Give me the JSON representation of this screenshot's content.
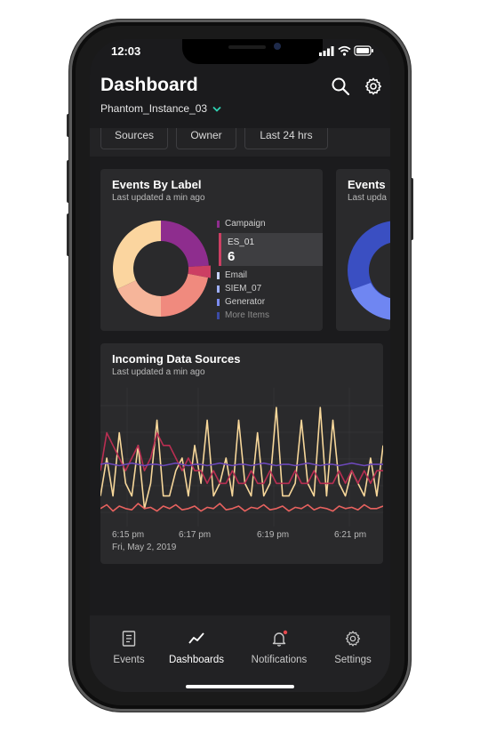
{
  "status_bar": {
    "time": "12:03"
  },
  "header": {
    "title": "Dashboard",
    "instance": "Phantom_Instance_03"
  },
  "filters": [
    "Sources",
    "Owner",
    "Last 24 hrs"
  ],
  "events_by_label": {
    "title": "Events By Label",
    "updated": "Last updated a min ago",
    "legend": [
      {
        "label": "Campaign",
        "color": "#8e2d8e"
      },
      {
        "label": "ES_01",
        "value": "6",
        "color": "#cc3f63"
      },
      {
        "label": "Email",
        "color": "#c8d3ff"
      },
      {
        "label": "SIEM_07",
        "color": "#9fb0ff"
      },
      {
        "label": "Generator",
        "color": "#7b8cf0"
      },
      {
        "label": "More Items",
        "color": "#3b4aa5"
      }
    ]
  },
  "events_second_card": {
    "title": "Events",
    "updated": "Last upda"
  },
  "incoming": {
    "title": "Incoming Data Sources",
    "updated": "Last updated a min ago",
    "x_ticks": [
      "6:15 pm",
      "6:17 pm",
      "6:19 pm",
      "6:21 pm"
    ],
    "date": "Fri, May 2, 2019"
  },
  "chart_data": {
    "type": "line",
    "title": "Incoming Data Sources",
    "x": [
      "6:15 pm",
      "6:17 pm",
      "6:19 pm",
      "6:21 pm"
    ],
    "series": [
      {
        "color": "#f7d79a",
        "values": [
          2,
          5,
          2,
          7,
          3,
          2,
          6,
          1,
          3,
          8,
          2,
          2,
          4,
          5,
          2,
          6,
          3,
          8,
          2,
          3,
          5,
          2,
          8,
          3,
          2,
          7,
          2,
          3,
          9,
          2,
          2,
          3,
          8,
          3,
          2,
          9,
          2,
          8,
          3,
          2,
          4,
          3,
          2,
          5,
          2,
          6
        ]
      },
      {
        "color": "#b92e52",
        "values": [
          4,
          7,
          6,
          5,
          4,
          5,
          6,
          4,
          5,
          7,
          6,
          6,
          5,
          4,
          5,
          4,
          4,
          3,
          4,
          3,
          3,
          4,
          3,
          3,
          4,
          3,
          3,
          4,
          3,
          3,
          3,
          4,
          3,
          3,
          4,
          3,
          3,
          3,
          4,
          3,
          4,
          3,
          4,
          3,
          4,
          4
        ]
      },
      {
        "color": "#6c48b8",
        "values": [
          4.5,
          4.6,
          4.5,
          4.4,
          4.5,
          4.6,
          4.5,
          4.4,
          4.5,
          4.5,
          4.4,
          4.5,
          4.6,
          4.5,
          4.4,
          4.5,
          4.5,
          4.4,
          4.5,
          4.6,
          4.5,
          4.4,
          4.5,
          4.5,
          4.4,
          4.5,
          4.6,
          4.5,
          4.4,
          4.5,
          4.5,
          4.4,
          4.5,
          4.6,
          4.5,
          4.4,
          4.5,
          4.5,
          4.4,
          4.5,
          4.6,
          4.5,
          4.4,
          4.5,
          4.5,
          4.5
        ]
      },
      {
        "color": "#e8625f",
        "values": [
          1,
          1.3,
          0.8,
          1.2,
          1,
          0.9,
          1.4,
          1,
          1.1,
          0.8,
          1.2,
          1,
          1.3,
          0.9,
          1,
          1.2,
          0.8,
          1.1,
          1,
          1.4,
          0.9,
          1,
          1.2,
          0.8,
          1.1,
          1,
          1.3,
          0.9,
          1,
          1.2,
          0.8,
          1.1,
          1,
          1.3,
          0.9,
          1.1,
          1,
          0.8,
          1.2,
          1,
          1.1,
          0.9,
          1.3,
          1,
          1,
          1.2
        ]
      }
    ],
    "grid": true
  },
  "tabs": [
    {
      "label": "Events",
      "icon": "events-icon"
    },
    {
      "label": "Dashboards",
      "icon": "dashboards-icon"
    },
    {
      "label": "Notifications",
      "icon": "notifications-icon"
    },
    {
      "label": "Settings",
      "icon": "settings-icon"
    }
  ]
}
